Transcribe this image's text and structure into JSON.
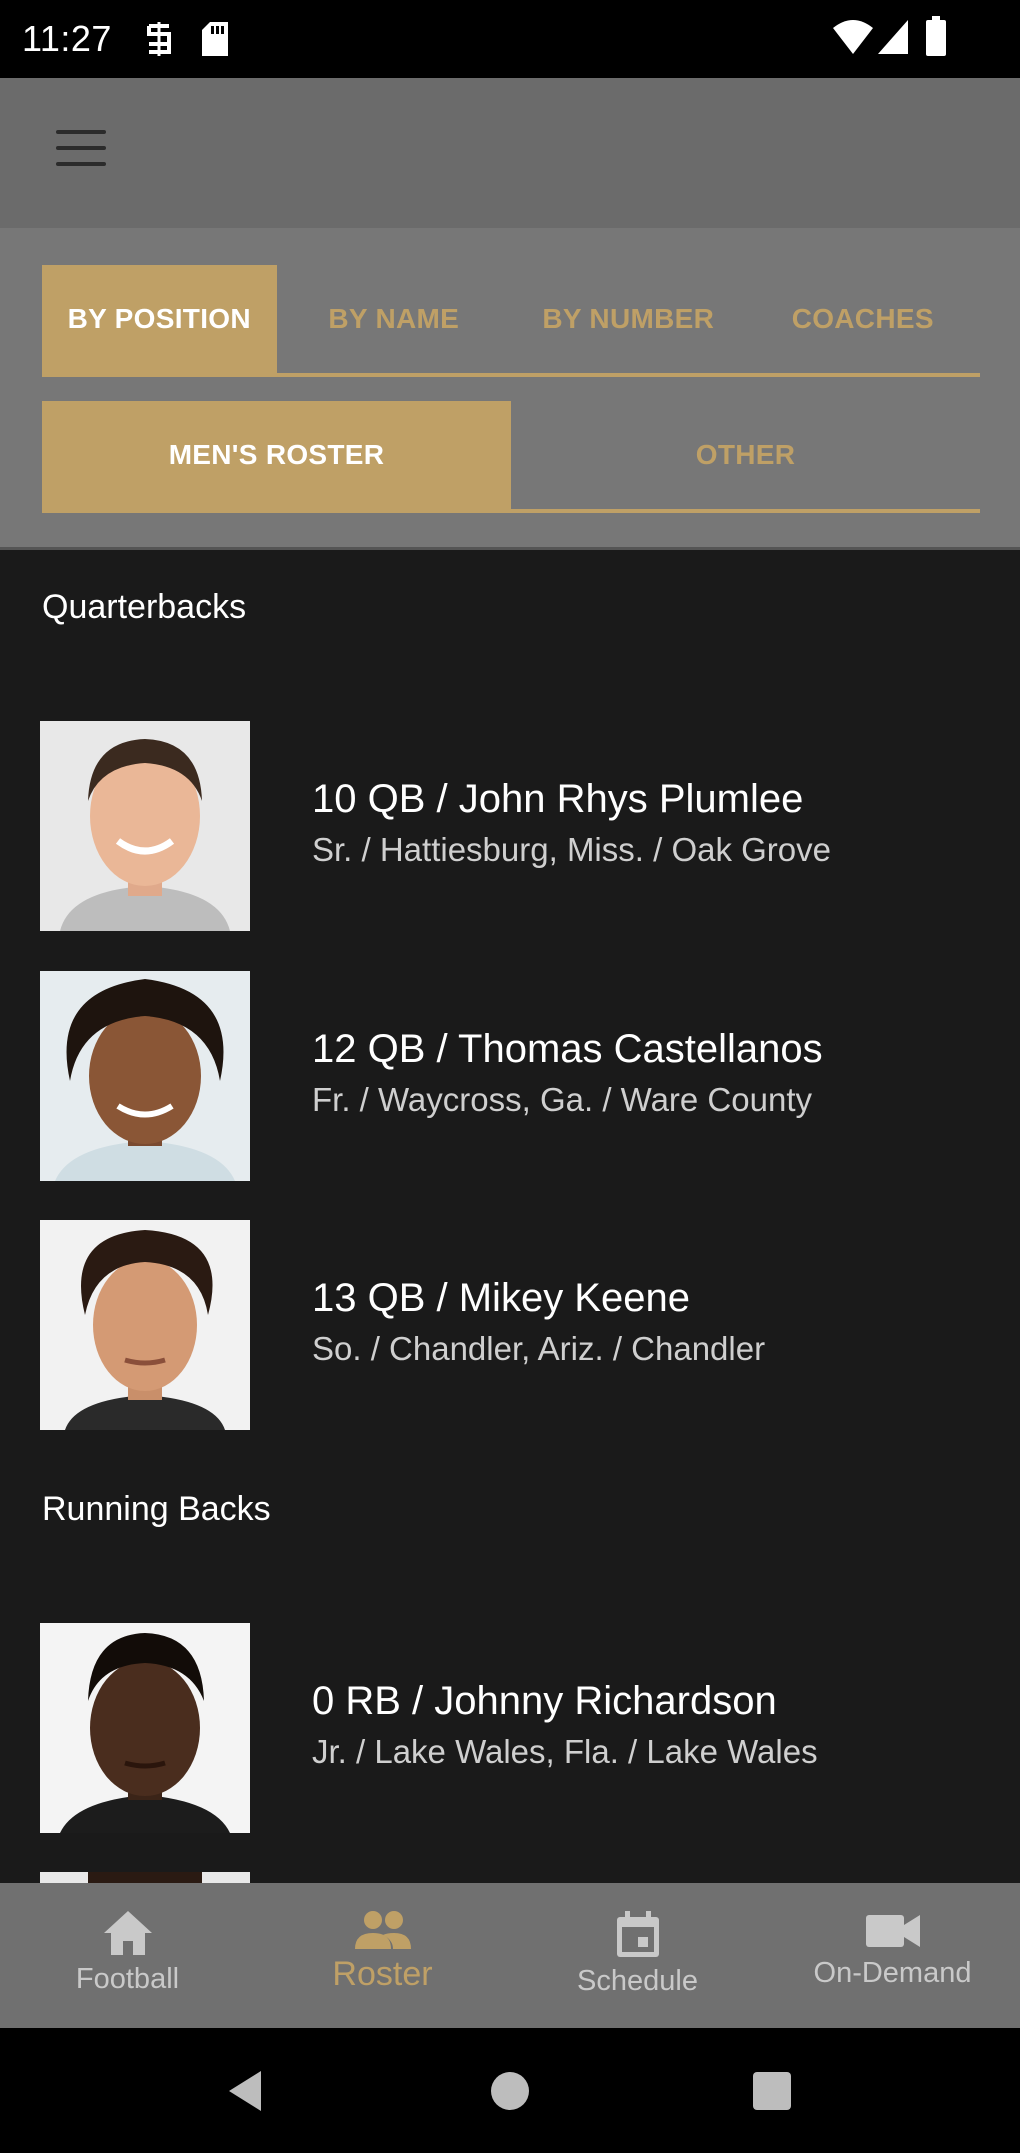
{
  "status_bar": {
    "time": "11:27"
  },
  "tabs": [
    {
      "label": "BY POSITION",
      "active": true
    },
    {
      "label": "BY NAME",
      "active": false
    },
    {
      "label": "BY NUMBER",
      "active": false
    },
    {
      "label": "COACHES",
      "active": false
    }
  ],
  "subtabs": [
    {
      "label": "MEN'S ROSTER",
      "active": true
    },
    {
      "label": "OTHER",
      "active": false
    }
  ],
  "sections": [
    {
      "title": "Quarterbacks",
      "players": [
        {
          "title": "10 QB / John Rhys Plumlee",
          "details": "Sr.  /  Hattiesburg, Miss.  /  Oak Grove"
        },
        {
          "title": "12 QB / Thomas Castellanos",
          "details": "Fr.  /  Waycross, Ga.  /  Ware County"
        },
        {
          "title": "13 QB / Mikey Keene",
          "details": "So.  /  Chandler, Ariz.  /  Chandler"
        }
      ]
    },
    {
      "title": "Running Backs",
      "players": [
        {
          "title": "0 RB / Johnny Richardson",
          "details": "Jr.  /  Lake Wales, Fla.  /  Lake Wales"
        }
      ]
    }
  ],
  "bottom_nav": [
    {
      "label": "Football",
      "icon": "home-icon",
      "active": false
    },
    {
      "label": "Roster",
      "icon": "people-icon",
      "active": true
    },
    {
      "label": "Schedule",
      "icon": "calendar-icon",
      "active": false
    },
    {
      "label": "On-Demand",
      "icon": "video-camera-icon",
      "active": false
    }
  ],
  "colors": {
    "accent": "#bfa066",
    "background": "#1a1a1a",
    "app_bar": "#6b6b6b",
    "nav_bar": "#707070"
  }
}
